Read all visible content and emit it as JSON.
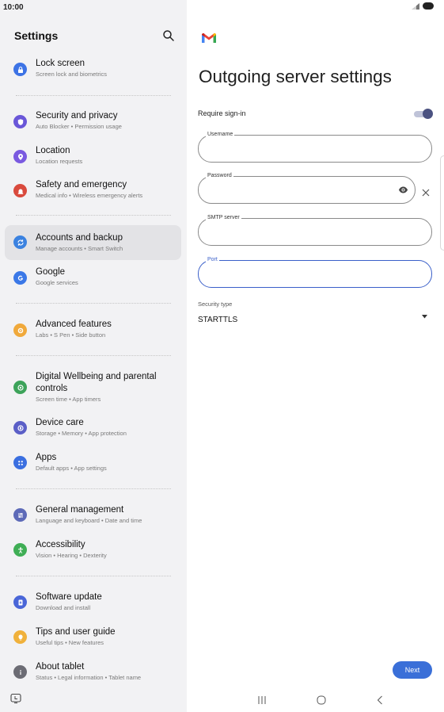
{
  "status_bar": {
    "time": "10:00"
  },
  "settings": {
    "title": "Settings",
    "items": [
      {
        "title": "Lock screen",
        "subtitle": "Screen lock and biometrics",
        "color": "#3d73e5",
        "icon": "lock-icon"
      },
      {
        "title": "Security and privacy",
        "subtitle": "Auto Blocker  •  Permission usage",
        "color": "#6a57d8",
        "icon": "shield-icon"
      },
      {
        "title": "Location",
        "subtitle": "Location requests",
        "color": "#7a5ae0",
        "icon": "location-pin-icon"
      },
      {
        "title": "Safety and emergency",
        "subtitle": "Medical info  •  Wireless emergency alerts",
        "color": "#d94a3d",
        "icon": "emergency-icon"
      },
      {
        "title": "Accounts and backup",
        "subtitle": "Manage accounts  •  Smart Switch",
        "color": "#3b82e0",
        "icon": "sync-icon"
      },
      {
        "title": "Google",
        "subtitle": "Google services",
        "color": "#3b78e7",
        "icon": "google-icon"
      },
      {
        "title": "Advanced features",
        "subtitle": "Labs  •  S Pen  •  Side button",
        "color": "#f0a93b",
        "icon": "gear-star-icon"
      },
      {
        "title": "Digital Wellbeing and parental controls",
        "title_line1": "Digital Wellbeing and parental",
        "title_line2": "controls",
        "subtitle": "Screen time  •  App timers",
        "color": "#3da35a",
        "icon": "wellbeing-icon"
      },
      {
        "title": "Device care",
        "subtitle": "Storage  •  Memory  •  App protection",
        "color": "#5b5fc7",
        "icon": "device-care-icon"
      },
      {
        "title": "Apps",
        "subtitle": "Default apps  •  App settings",
        "color": "#3b6fe0",
        "icon": "apps-grid-icon"
      },
      {
        "title": "General management",
        "subtitle": "Language and keyboard  •  Date and time",
        "color": "#5d6ab8",
        "icon": "sliders-icon"
      },
      {
        "title": "Accessibility",
        "subtitle": "Vision  •  Hearing  •  Dexterity",
        "color": "#3fae55",
        "icon": "accessibility-icon"
      },
      {
        "title": "Software update",
        "subtitle": "Download and install",
        "color": "#4a66d8",
        "icon": "software-update-icon"
      },
      {
        "title": "Tips and user guide",
        "subtitle": "Useful tips  •  New features",
        "color": "#f0b13b",
        "icon": "lightbulb-icon"
      },
      {
        "title": "About tablet",
        "subtitle": "Status  •  Legal information  •  Tablet name",
        "color": "#6c6c74",
        "icon": "info-icon"
      }
    ]
  },
  "email": {
    "title": "Outgoing server settings",
    "require_signin_label": "Require sign-in",
    "require_signin_on": true,
    "fields": {
      "username": {
        "label": "Username",
        "value": ""
      },
      "password": {
        "label": "Password",
        "value": ""
      },
      "smtp": {
        "label": "SMTP server",
        "value": ""
      },
      "port": {
        "label": "Port",
        "value": ""
      }
    },
    "security_type_label": "Security type",
    "security_type_value": "STARTTLS",
    "next_label": "Next",
    "accent_color": "#3a6fd8"
  }
}
